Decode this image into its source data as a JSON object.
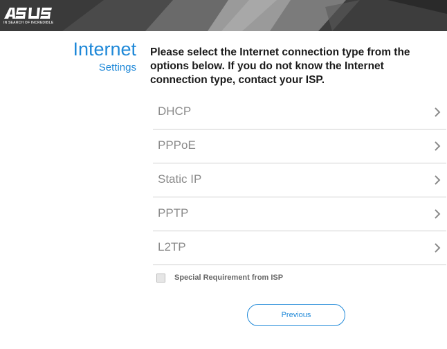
{
  "header": {
    "logo_text": "ASUS",
    "logo_tagline": "IN SEARCH OF INCREDIBLE"
  },
  "side_title": {
    "main": "Internet",
    "sub": "Settings"
  },
  "instruction": "Please select the Internet connection type from the options below. If you do not know the Internet connection type, contact your ISP.",
  "options": [
    {
      "label": "DHCP",
      "icon": "chevron-right-icon"
    },
    {
      "label": "PPPoE",
      "icon": "chevron-right-icon"
    },
    {
      "label": "Static IP",
      "icon": "chevron-right-icon"
    },
    {
      "label": "PPTP",
      "icon": "chevron-right-icon"
    },
    {
      "label": "L2TP",
      "icon": "chevron-right-icon"
    }
  ],
  "special_requirement": {
    "label": "Special Requirement from ISP",
    "checked": false
  },
  "previous_button": {
    "label": "Previous"
  },
  "colors": {
    "accent": "#1e88d8",
    "header_bg": "#2b2b2b",
    "option_text": "#8a8a8a",
    "divider": "#cfcfcf"
  }
}
